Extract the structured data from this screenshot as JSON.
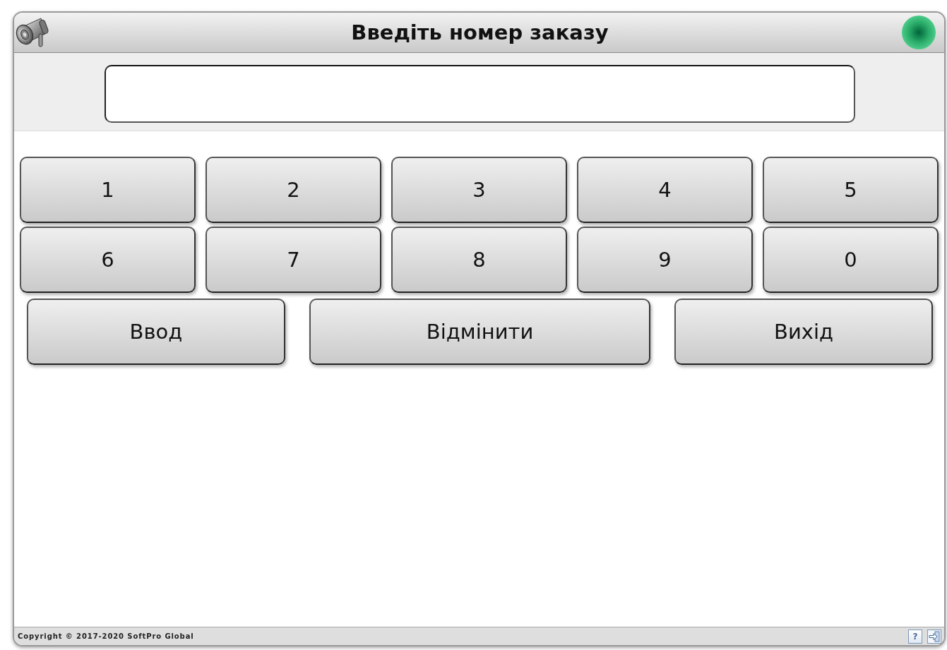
{
  "window": {
    "title": "Введіть номер заказу"
  },
  "keypad": {
    "rows": [
      [
        "1",
        "2",
        "3",
        "4",
        "5"
      ],
      [
        "6",
        "7",
        "8",
        "9",
        "0"
      ]
    ]
  },
  "actions": [
    "Ввод",
    "Відмінити",
    "Вихід"
  ],
  "footer": {
    "copyright": "Copyright © 2017-2020 SoftPro Global",
    "help_label": "?"
  }
}
